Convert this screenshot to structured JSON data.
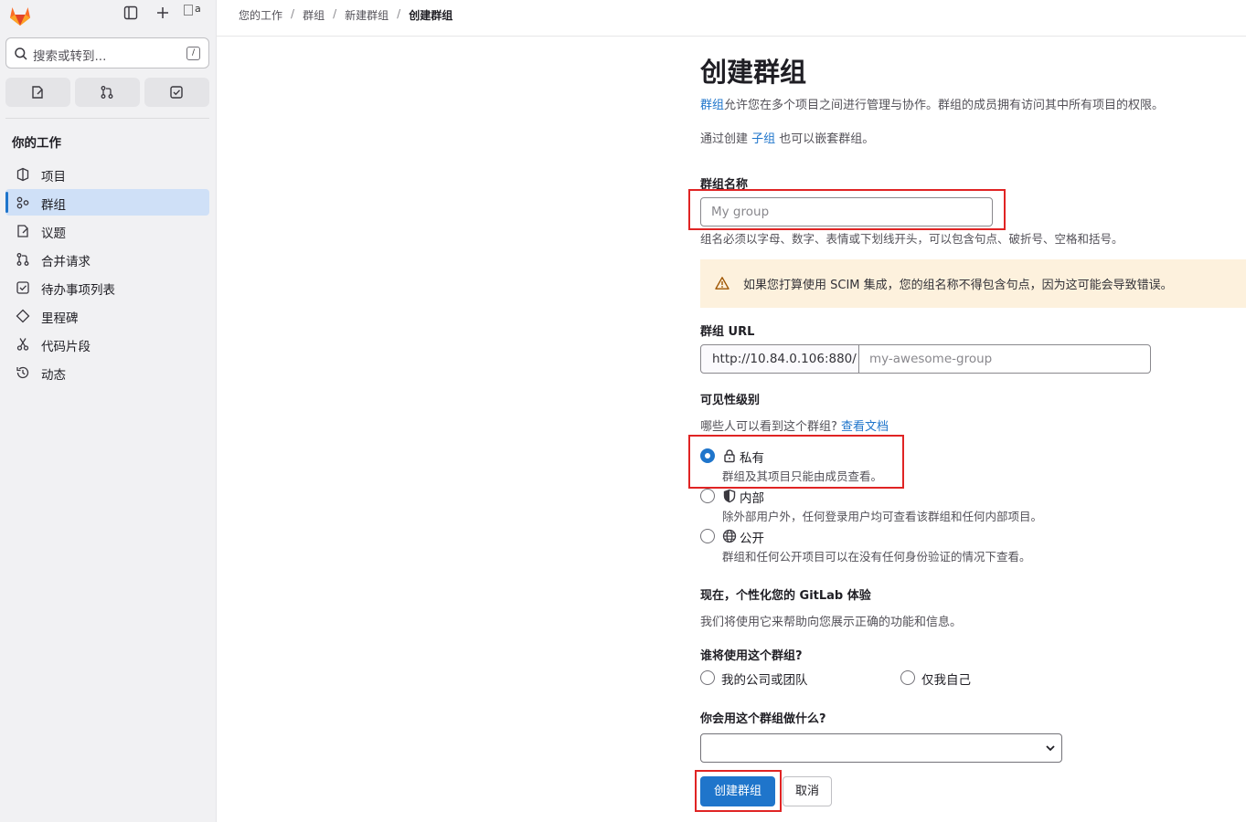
{
  "sidebar": {
    "search_placeholder": "搜索或转到...",
    "search_shortcut": "/",
    "avatar_alt": "a",
    "section_title": "你的工作",
    "items": [
      {
        "label": "项目",
        "icon": "project-icon"
      },
      {
        "label": "群组",
        "icon": "group-icon",
        "active": true
      },
      {
        "label": "议题",
        "icon": "issues-icon"
      },
      {
        "label": "合并请求",
        "icon": "merge-request-icon"
      },
      {
        "label": "待办事项列表",
        "icon": "todo-icon"
      },
      {
        "label": "里程碑",
        "icon": "milestone-icon"
      },
      {
        "label": "代码片段",
        "icon": "snippet-icon"
      },
      {
        "label": "动态",
        "icon": "history-icon"
      }
    ]
  },
  "breadcrumb": [
    "您的工作",
    "群组",
    "新建群组",
    "创建群组"
  ],
  "page": {
    "title": "创建群组",
    "desc_link": "群组",
    "desc_rest": "允许您在多个项目之间进行管理与协作。群组的成员拥有访问其中所有项目的权限。",
    "subgroup_pre": "通过创建 ",
    "subgroup_link": "子组",
    "subgroup_post": " 也可以嵌套群组。"
  },
  "form": {
    "group_name_label": "群组名称",
    "group_name_placeholder": "My group",
    "group_name_help": "组名必须以字母、数字、表情或下划线开头，可以包含句点、破折号、空格和括号。",
    "scim_warning": "如果您打算使用 SCIM 集成，您的组名称不得包含句点，因为这可能会导致错误。",
    "url_label": "群组 URL",
    "url_prefix": "http://10.84.0.106:880/",
    "url_placeholder": "my-awesome-group",
    "visibility_label": "可见性级别",
    "visibility_question": "哪些人可以看到这个群组?",
    "visibility_docs_link": "查看文档",
    "visibility_options": [
      {
        "label": "私有",
        "help": "群组及其项目只能由成员查看。",
        "icon": "lock-icon",
        "checked": true
      },
      {
        "label": "内部",
        "help": "除外部用户外，任何登录用户均可查看该群组和任何内部项目。",
        "icon": "shield-icon",
        "checked": false
      },
      {
        "label": "公开",
        "help": "群组和任何公开项目可以在没有任何身份验证的情况下查看。",
        "icon": "earth-icon",
        "checked": false
      }
    ],
    "personalize_title": "现在，个性化您的 GitLab 体验",
    "personalize_desc": "我们将使用它来帮助向您展示正确的功能和信息。",
    "who_label": "谁将使用这个群组?",
    "who_options": [
      "我的公司或团队",
      "仅我自己"
    ],
    "what_label": "你会用这个群组做什么?",
    "what_selected": "",
    "create_button": "创建群组",
    "cancel_button": "取消"
  },
  "colors": {
    "primary": "#1f75cb",
    "highlight_box": "#e02424",
    "warning_bg": "#fdf1dd"
  }
}
